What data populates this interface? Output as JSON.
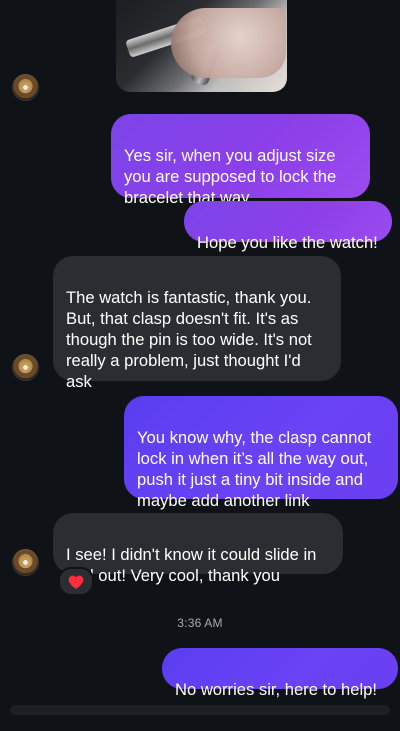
{
  "messages": [
    {
      "side": "sent",
      "text": "Yes sir, when you adjust size you are supposed to lock the bracelet that way"
    },
    {
      "side": "sent",
      "text": "Hope you like the watch!"
    },
    {
      "side": "received",
      "text": "The watch is fantastic, thank you. But, that clasp doesn't fit. It's as though the pin is too wide. It's not really a problem, just thought I'd ask"
    },
    {
      "side": "sent",
      "text": "You know why, the clasp cannot lock in when it’s all the way out, push it just a tiny bit inside and maybe add another link"
    },
    {
      "side": "received",
      "text": "I see! I didn't know it could slide in and out! Very cool, thank you",
      "reaction": "❤️"
    },
    {
      "side": "sent",
      "text": "No worries sir, here to help!"
    }
  ],
  "timestamp": "3:36 AM",
  "colors": {
    "background": "#0f1317",
    "sent_bubble": "#8a43ea",
    "sent_bubble_deep": "#5f40f2",
    "received_bubble": "#2a2d31",
    "reaction_heart": "#ff2e3d"
  },
  "icons": {
    "avatar": "contact-avatar-icon",
    "reaction": "heart-reaction-icon"
  }
}
